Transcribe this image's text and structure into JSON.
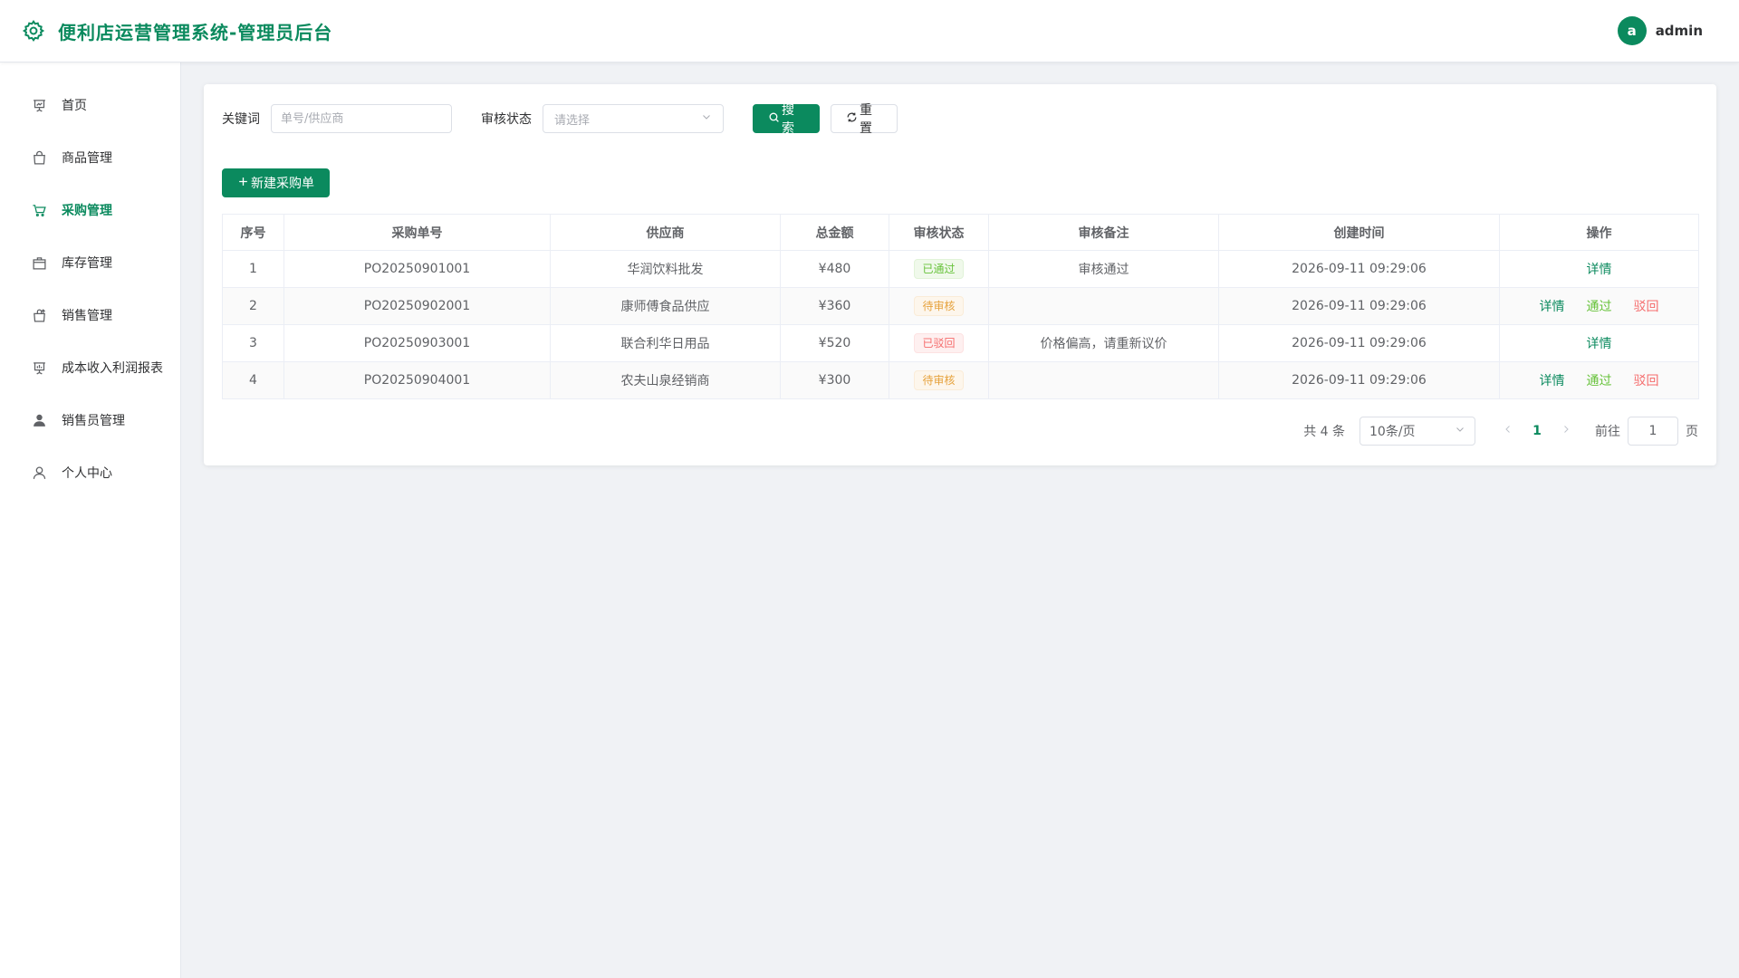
{
  "header": {
    "title": "便利店运营管理系统-管理员后台",
    "avatar_letter": "a",
    "username": "admin"
  },
  "sidebar": {
    "items": [
      {
        "label": "首页",
        "icon": "chart-board-icon",
        "active": false
      },
      {
        "label": "商品管理",
        "icon": "shopping-bag-icon",
        "active": false
      },
      {
        "label": "采购管理",
        "icon": "shopping-cart-icon",
        "active": true
      },
      {
        "label": "库存管理",
        "icon": "box-icon",
        "active": false
      },
      {
        "label": "销售管理",
        "icon": "sell-bag-icon",
        "active": false
      },
      {
        "label": "成本收入利润报表",
        "icon": "report-board-icon",
        "active": false
      },
      {
        "label": "销售员管理",
        "icon": "user-filled-icon",
        "active": false
      },
      {
        "label": "个人中心",
        "icon": "user-outline-icon",
        "active": false
      }
    ]
  },
  "filters": {
    "keyword_label": "关键词",
    "keyword_placeholder": "单号/供应商",
    "status_label": "审核状态",
    "status_placeholder": "请选择",
    "search_label": "搜索",
    "reset_label": "重置"
  },
  "new_button_label": "新建采购单",
  "table": {
    "columns": [
      "序号",
      "采购单号",
      "供应商",
      "总金额",
      "审核状态",
      "审核备注",
      "创建时间",
      "操作"
    ],
    "rows": [
      {
        "index": "1",
        "order_no": "PO20250901001",
        "supplier": "华润饮料批发",
        "amount": "¥480",
        "status": "已通过",
        "status_type": "pass",
        "remark": "审核通过",
        "created": "2026-09-11 09:29:06",
        "actions": [
          "详情"
        ]
      },
      {
        "index": "2",
        "order_no": "PO20250902001",
        "supplier": "康师傅食品供应",
        "amount": "¥360",
        "status": "待审核",
        "status_type": "pending",
        "remark": "",
        "created": "2026-09-11 09:29:06",
        "actions": [
          "详情",
          "通过",
          "驳回"
        ]
      },
      {
        "index": "3",
        "order_no": "PO20250903001",
        "supplier": "联合利华日用品",
        "amount": "¥520",
        "status": "已驳回",
        "status_type": "reject",
        "remark": "价格偏高，请重新议价",
        "created": "2026-09-11 09:29:06",
        "actions": [
          "详情"
        ]
      },
      {
        "index": "4",
        "order_no": "PO20250904001",
        "supplier": "农夫山泉经销商",
        "amount": "¥300",
        "status": "待审核",
        "status_type": "pending",
        "remark": "",
        "created": "2026-09-11 09:29:06",
        "actions": [
          "详情",
          "通过",
          "驳回"
        ]
      }
    ]
  },
  "pagination": {
    "total_text": "共 4 条",
    "page_size": "10条/页",
    "current_page": "1",
    "goto_label": "前往",
    "goto_value": "1",
    "page_unit": "页"
  },
  "colors": {
    "brand": "#0b8a5e",
    "pass": "#67c23a",
    "pending": "#e6a23c",
    "reject": "#f56c6c"
  }
}
